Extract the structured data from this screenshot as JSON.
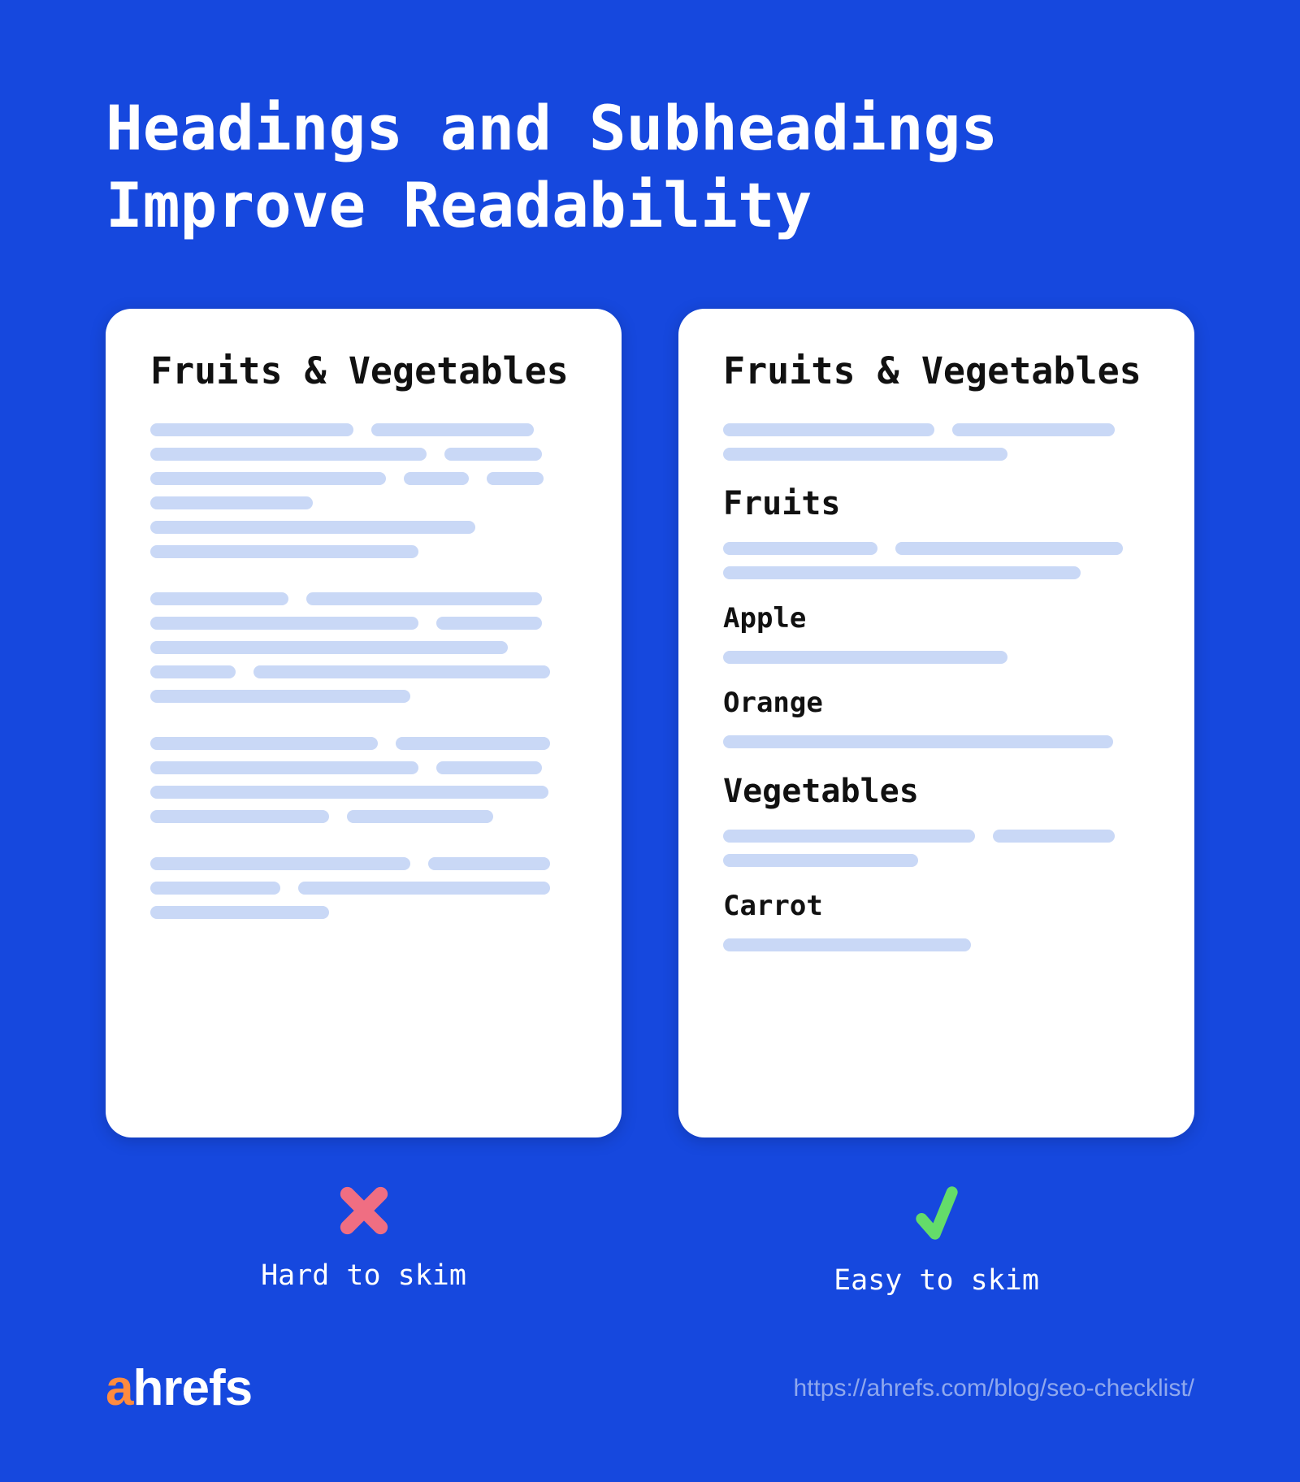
{
  "title": "Headings and Subheadings\nImprove Readability",
  "left": {
    "card_title": "Fruits & Vegetables",
    "status_label": "Hard to skim",
    "status": "bad"
  },
  "right": {
    "card_title": "Fruits & Vegetables",
    "h2_fruits": "Fruits",
    "h3_apple": "Apple",
    "h3_orange": "Orange",
    "h2_vegetables": "Vegetables",
    "h3_carrot": "Carrot",
    "status_label": "Easy to skim",
    "status": "good"
  },
  "logo": {
    "a": "a",
    "rest": "hrefs"
  },
  "url": "https://ahrefs.com/blog/seo-checklist/",
  "colors": {
    "bg": "#1648de",
    "placeholder": "#c9d8f6",
    "bad": "#f06e82",
    "good": "#64dc6a",
    "logo_a": "#ff8b3e"
  }
}
